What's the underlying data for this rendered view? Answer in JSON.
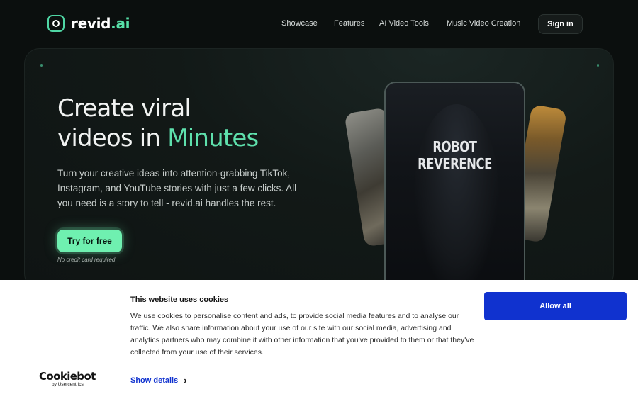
{
  "header": {
    "logo": {
      "main": "revid",
      "accent": ".ai"
    },
    "nav": [
      "Showcase",
      "Features",
      "AI Video Tools",
      "Music Video Creation"
    ],
    "signin_label": "Sign in"
  },
  "hero": {
    "headline_line1": "Create viral",
    "headline_line2_prefix": "videos in ",
    "headline_accent": "Minutes",
    "subtitle": "Turn your creative ideas into attention-grabbing TikTok, Instagram, and YouTube stories with just a few clicks. All you need is a story to tell - revid.ai handles the rest.",
    "cta_label": "Try for free",
    "cta_note": "No credit card required",
    "phone_title": "ROBOT REVERENCE",
    "accent_color": "#5ee0ac"
  },
  "cookie_banner": {
    "title": "This website uses cookies",
    "body": "We use cookies to personalise content and ads, to provide social media features and to analyse our traffic. We also share information about your use of our site with our social media, advertising and analytics partners who may combine it with other information that you've provided to them or that they've collected from your use of their services.",
    "allow_label": "Allow all",
    "details_label": "Show details",
    "brand_main": "Cookiebot",
    "brand_sub": "by Usercentrics",
    "button_color": "#1032cf"
  }
}
